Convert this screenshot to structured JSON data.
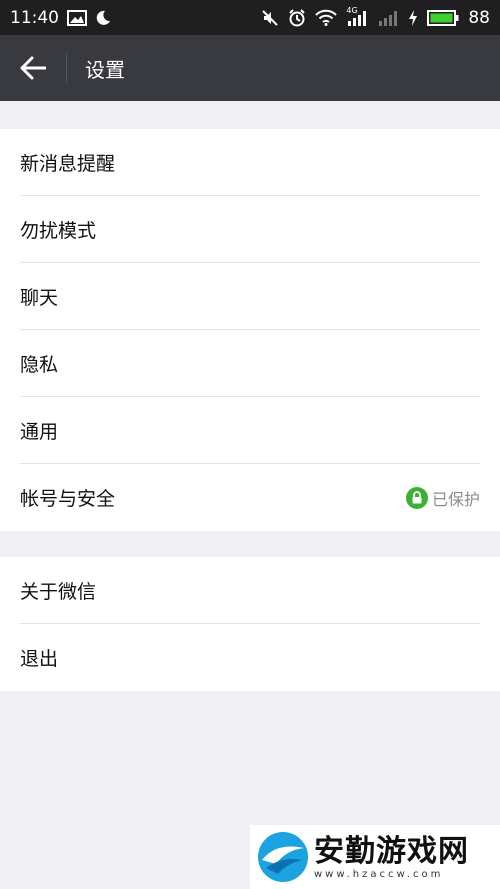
{
  "status_bar": {
    "time": "11:40",
    "battery": "88",
    "network": "4G",
    "icons": [
      "image-icon",
      "moon-icon",
      "mute-icon",
      "alarm-icon",
      "wifi-icon",
      "signal-icon",
      "signal-icon",
      "charging-icon",
      "battery-icon"
    ]
  },
  "header": {
    "title": "设置",
    "back_icon": "arrow-left-icon"
  },
  "settings_group_1": [
    {
      "label": "新消息提醒"
    },
    {
      "label": "勿扰模式"
    },
    {
      "label": "聊天"
    },
    {
      "label": "隐私"
    },
    {
      "label": "通用"
    },
    {
      "label": "帐号与安全",
      "status": "已保护",
      "status_icon": "lock-icon"
    }
  ],
  "settings_group_2": [
    {
      "label": "关于微信"
    },
    {
      "label": "退出"
    }
  ],
  "watermark": {
    "text": "安勤游戏网",
    "url": "www.hzaccw.com"
  },
  "colors": {
    "status_bar_bg": "#1f1f1f",
    "header_bg": "#393a3f",
    "page_bg": "#efeff4",
    "protect_green": "#3cb034",
    "battery_green": "#3cd12d"
  }
}
